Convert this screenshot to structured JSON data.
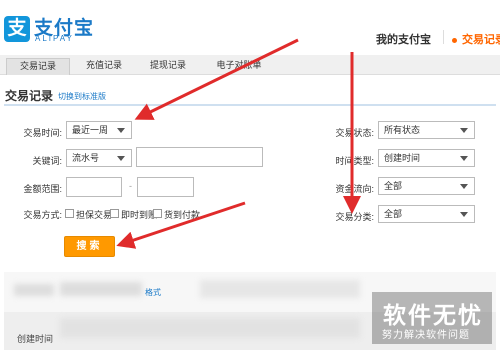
{
  "header": {
    "logo_text": "支付宝",
    "logo_sub": "ALIPAY",
    "my_alipay": "我的支付宝",
    "current_nav": "交易记录"
  },
  "tabs": [
    {
      "label": "交易记录",
      "active": true
    },
    {
      "label": "充值记录",
      "active": false
    },
    {
      "label": "提现记录",
      "active": false
    },
    {
      "label": "电子对账单",
      "active": false
    }
  ],
  "section": {
    "title": "交易记录",
    "switch_link": "切换到标准版"
  },
  "filters": {
    "time_label": "交易时间:",
    "time_value": "最近一周",
    "keyword_label": "关键词:",
    "keyword_type": "流水号",
    "keyword_value": "",
    "amount_label": "金额范围:",
    "amount_min": "",
    "amount_dash": "-",
    "amount_max": "",
    "method_label": "交易方式:",
    "methods": [
      {
        "label": "担保交易",
        "checked": false
      },
      {
        "label": "即时到账",
        "checked": false
      },
      {
        "label": "货到付款",
        "checked": false
      }
    ],
    "status_label": "交易状态:",
    "status_value": "所有状态",
    "time_type_label": "时间类型:",
    "time_type_value": "创建时间",
    "flow_label": "资金流向:",
    "flow_value": "全部",
    "category_label": "交易分类:",
    "category_value": "全部",
    "search_button": "搜索"
  },
  "results": {
    "format_link": "格式",
    "column_created": "创建时间"
  },
  "watermark": {
    "title": "软件无忧",
    "subtitle": "努力解决软件问题"
  },
  "colors": {
    "accent_orange": "#ff9900",
    "brand_blue": "#1a79c7",
    "arrow_red": "#e02b2b"
  }
}
